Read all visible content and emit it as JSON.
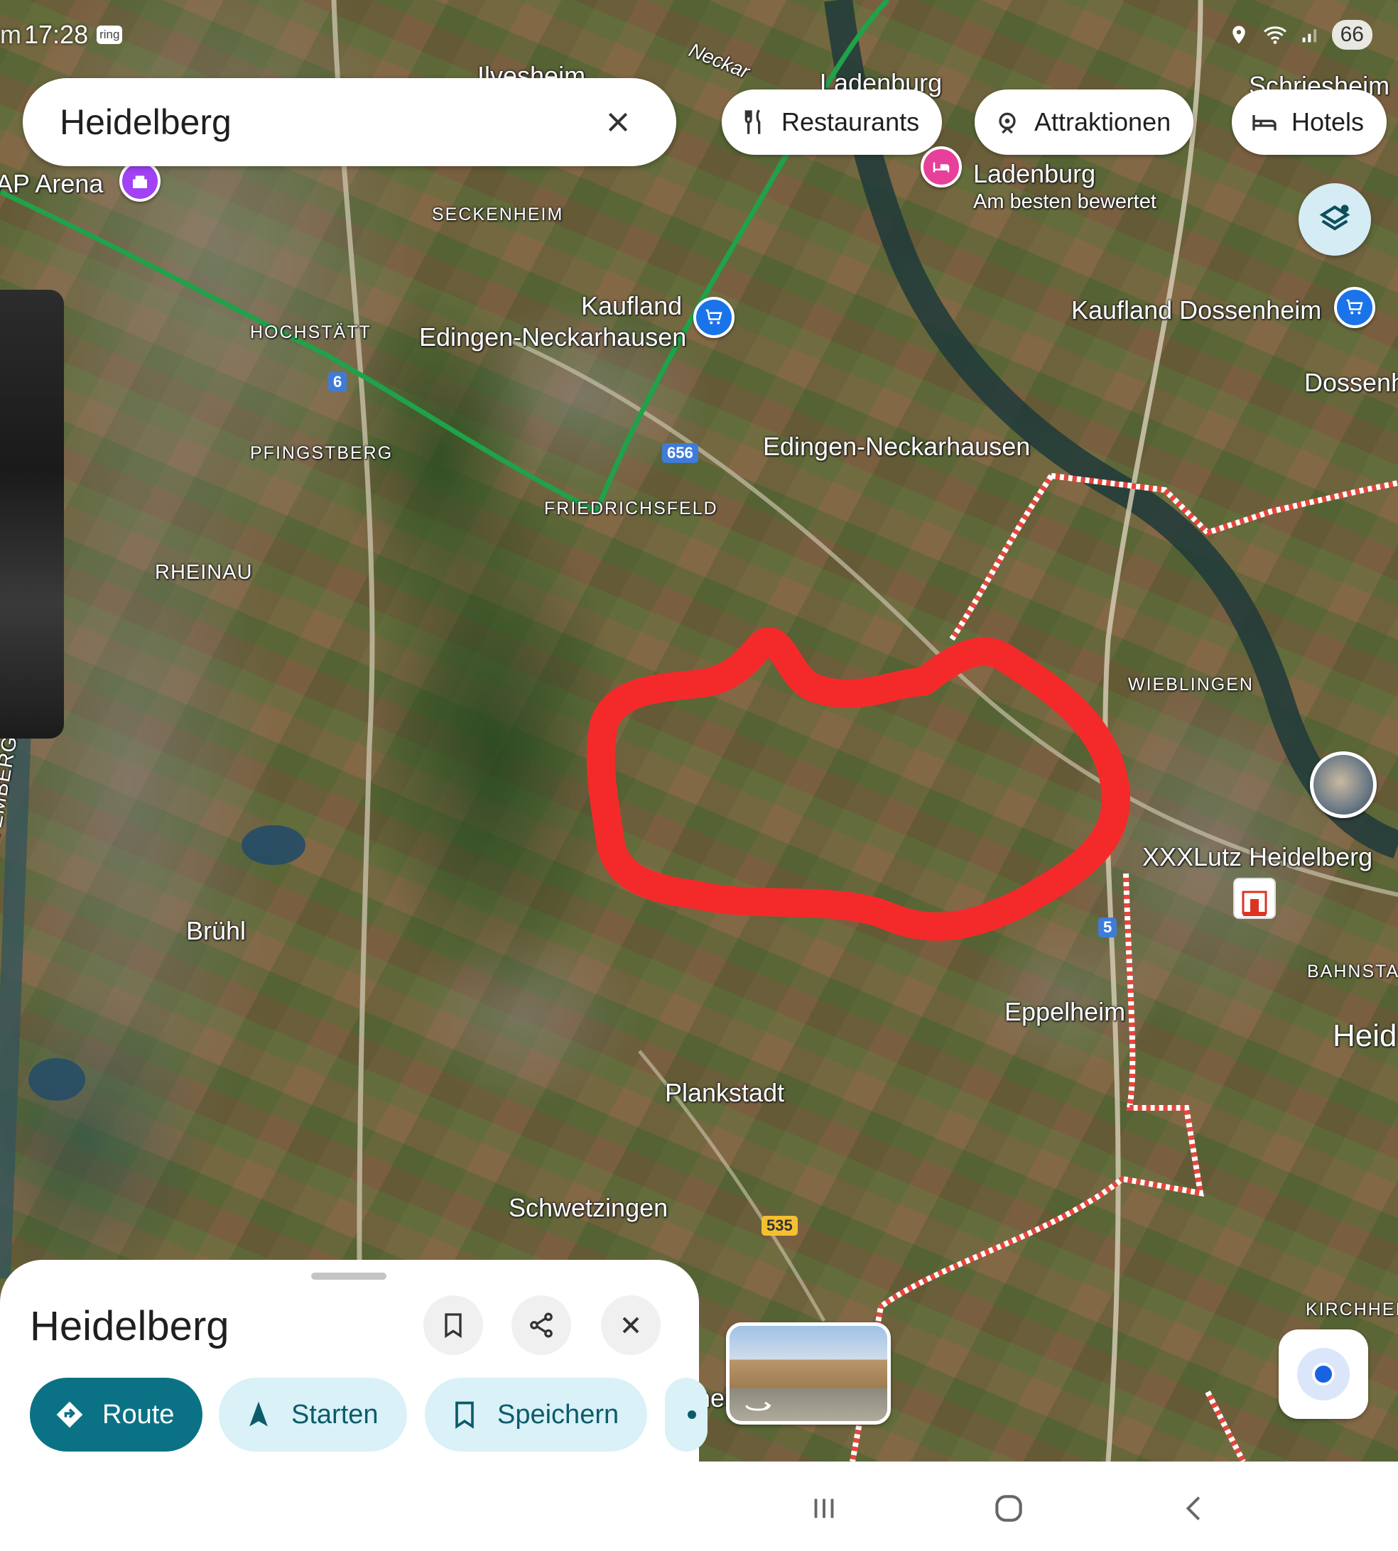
{
  "status_bar": {
    "partial_left": "m",
    "time": "17:28",
    "carrier_badge": "ring",
    "battery": "66",
    "icons": [
      "location-icon",
      "wifi-icon",
      "signal-icon"
    ]
  },
  "search": {
    "query": "Heidelberg",
    "clear_icon": "close-icon"
  },
  "category_chips": [
    {
      "label": "Restaurants",
      "icon": "fork-knife-icon"
    },
    {
      "label": "Attraktionen",
      "icon": "attraction-icon"
    },
    {
      "label": "Hotels",
      "icon": "bed-icon"
    }
  ],
  "map": {
    "places": {
      "ilvesheim": "Ilvesheim",
      "ladenburg_top": "Ladenburg",
      "schriesheim": "Schriesheim",
      "neckar": "Neckar",
      "sap_arena": "AP Arena",
      "seckenheim": "SECKENHEIM",
      "hotel_ladenburg": "Ladenburg",
      "hotel_rating": "Am besten bewertet",
      "hochstaett": "HOCHSTÄTT",
      "kaufland_edingen_1": "Kaufland",
      "kaufland_edingen_2": "Edingen-Neckarhausen",
      "kaufland_dossenheim": "Kaufland Dossenheim",
      "dossenheim": "Dossenh",
      "pfingstberg": "PFINGSTBERG",
      "edingen": "Edingen-Neckarhausen",
      "friedrichsfeld": "FRIEDRICHSFELD",
      "rheinau": "RHEINAU",
      "wieblingen": "WIEBLINGEN",
      "xxxlutz": "XXXLutz Heidelberg",
      "bruehl": "Brühl",
      "wuerttemberg": "TTEMBERG",
      "bahnstadt": "BAHNSTAD",
      "eppelheim": "Eppelheim",
      "heidelberg_partial": "Heid",
      "plankstadt": "Plankstadt",
      "schwetzingen": "Schwetzingen",
      "kirchheim": "KIRCHHEIM",
      "photo_partial": "hei"
    },
    "road_shields": {
      "r6": "6",
      "r656": "656",
      "r5": "5",
      "r535": "535"
    },
    "colors": {
      "highlight_stroke": "#f42a2a",
      "transit_line": "#1fa24a",
      "boundary": "#e8453c",
      "shopping_pin": "#1a73e8",
      "attraction_pin": "#a142f4",
      "hotel_pin": "#e8409a"
    }
  },
  "sheet": {
    "title": "Heidelberg",
    "actions": [
      {
        "name": "save-icon-button",
        "icon": "bookmark-icon"
      },
      {
        "name": "share-button",
        "icon": "share-icon"
      },
      {
        "name": "close-sheet-button",
        "icon": "close-icon"
      }
    ],
    "buttons": {
      "route": "Route",
      "start": "Starten",
      "save": "Speichern"
    }
  },
  "navbar": {
    "icons": [
      "recent-apps-icon",
      "home-icon",
      "back-icon"
    ]
  }
}
